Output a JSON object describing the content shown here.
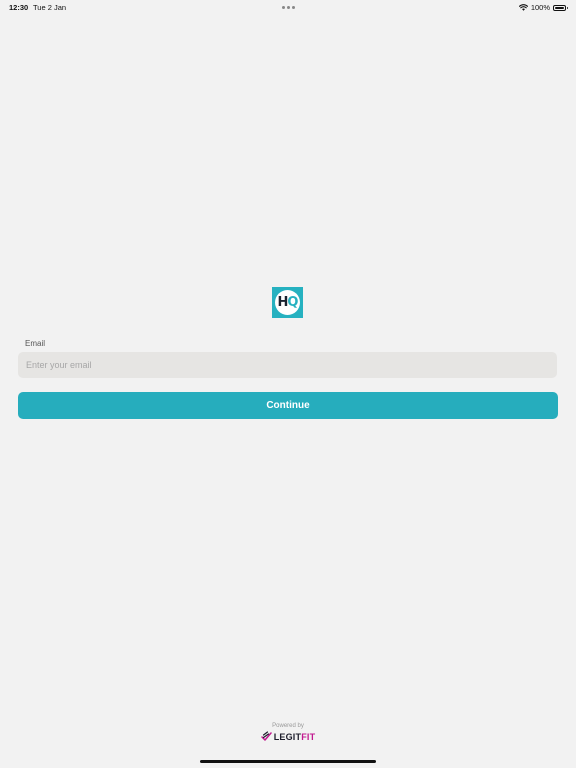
{
  "status_bar": {
    "time": "12:30",
    "date": "Tue 2 Jan",
    "battery": "100%",
    "battery_level": 1.0,
    "icons": [
      "wifi-icon",
      "battery-icon"
    ]
  },
  "logo": {
    "letter_h": "H",
    "letter_q": "Q",
    "color": "#26b1c0"
  },
  "form": {
    "email_label": "Email",
    "email_placeholder": "Enter your email",
    "email_value": ""
  },
  "actions": {
    "continue_label": "Continue",
    "continue_color": "#26adbd"
  },
  "footer": {
    "powered_by": "Powered by",
    "brand_main": "LEGIT",
    "brand_accent": "FIT",
    "brand_icon": "legitfit-logo-icon",
    "accent_color": "#c2188f"
  }
}
